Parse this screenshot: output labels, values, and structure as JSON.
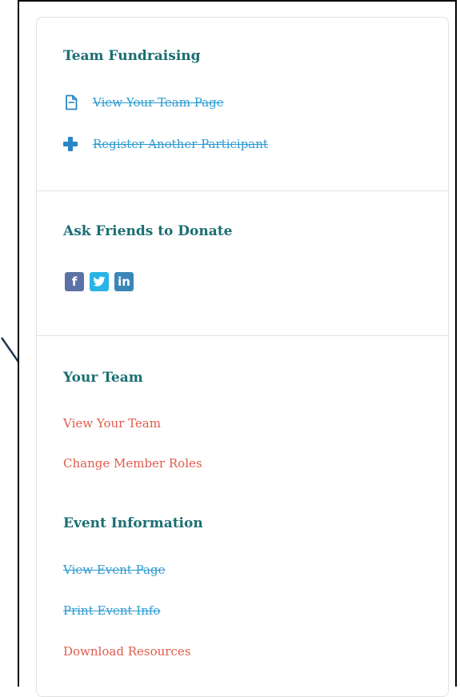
{
  "team_fundraising": {
    "heading": "Team Fundraising",
    "links": {
      "view_team_page": "View Your Team Page",
      "register_participant": "Register Another Participant"
    },
    "icons": {
      "view_team_page": "document-icon",
      "register_participant": "plus-icon"
    }
  },
  "ask_friends": {
    "heading": "Ask Friends to Donate",
    "social": {
      "facebook": "f",
      "twitter": "twitter-bird-icon",
      "linkedin": "in"
    }
  },
  "your_team": {
    "heading": "Your Team",
    "links": {
      "view_team": "View Your Team",
      "change_roles": "Change Member Roles"
    }
  },
  "event_information": {
    "heading": "Event Information",
    "links": {
      "view_event_page": "View Event Page",
      "print_event_info": "Print Event Info",
      "download_resources": "Download Resources"
    }
  },
  "colors": {
    "heading": "#1b6e72",
    "link_blue": "#2d9ad2",
    "link_red": "#e05b4c",
    "facebook": "#5c72a6",
    "twitter": "#28b5e6",
    "linkedin": "#3a86b9",
    "arrow": "#1f3a55"
  }
}
